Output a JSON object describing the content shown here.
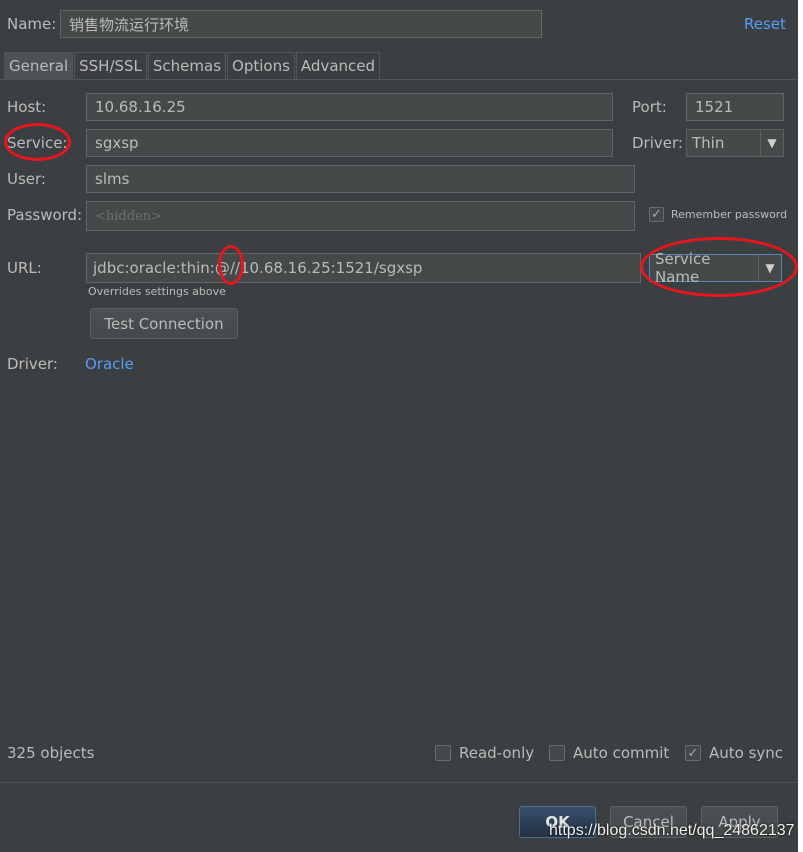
{
  "header": {
    "name_label": "Name:",
    "name_value": "销售物流运行环境",
    "reset_label": "Reset"
  },
  "tabs": [
    {
      "label": "General",
      "active": true
    },
    {
      "label": "SSH/SSL",
      "active": false
    },
    {
      "label": "Schemas",
      "active": false
    },
    {
      "label": "Options",
      "active": false
    },
    {
      "label": "Advanced",
      "active": false
    }
  ],
  "form": {
    "host_label": "Host:",
    "host_value": "10.68.16.25",
    "port_label": "Port:",
    "port_value": "1521",
    "service_label": "Service:",
    "service_value": "sgxsp",
    "driver_label": "Driver:",
    "driver_value": "Thin",
    "user_label": "User:",
    "user_value": "slms",
    "password_label": "Password:",
    "password_placeholder": "<hidden>",
    "remember_label": "Remember password",
    "remember_checked": true,
    "url_label": "URL:",
    "url_value": "jdbc:oracle:thin:@//10.68.16.25:1521/sgxsp",
    "url_type": "Service Name",
    "url_hint": "Overrides settings above",
    "test_button": "Test Connection",
    "driver2_label": "Driver:",
    "driver2_value": "Oracle"
  },
  "footer": {
    "objects": "325 objects",
    "readonly_label": "Read-only",
    "readonly_checked": false,
    "autocommit_label": "Auto commit",
    "autocommit_checked": false,
    "autosync_label": "Auto sync",
    "autosync_checked": true,
    "ok_label": "OK",
    "cancel_label": "Cancel",
    "apply_label": "Apply"
  },
  "watermark": "https://blog.csdn.net/qq_24862137",
  "icons": {
    "check": "checkmark-icon",
    "dropdown": "chevron-down-icon"
  },
  "colors": {
    "background": "#3c3f41",
    "field": "#45494a",
    "link": "#589df6",
    "annotation": "#e8151c"
  }
}
